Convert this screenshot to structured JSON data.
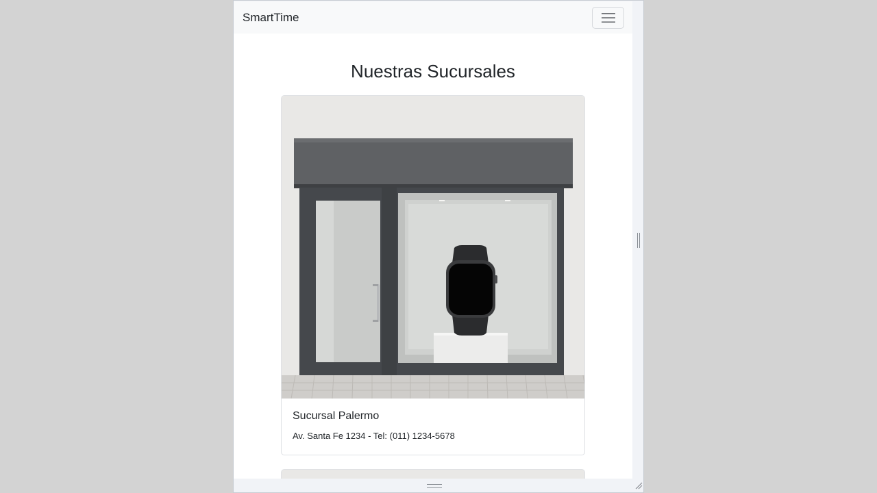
{
  "navbar": {
    "brand": "SmartTime",
    "menu_icon": "hamburger-menu-icon"
  },
  "main": {
    "title": "Nuestras Sucursales",
    "branches": [
      {
        "name": "Sucursal Palermo",
        "info": "Av. Santa Fe 1234 - Tel: (011) 1234-5678",
        "image_icon": "storefront-with-smartwatch-image"
      }
    ]
  },
  "colors": {
    "navbar_bg": "#f8f9fa",
    "text": "#212529",
    "backdrop": "#d3d3d3"
  }
}
